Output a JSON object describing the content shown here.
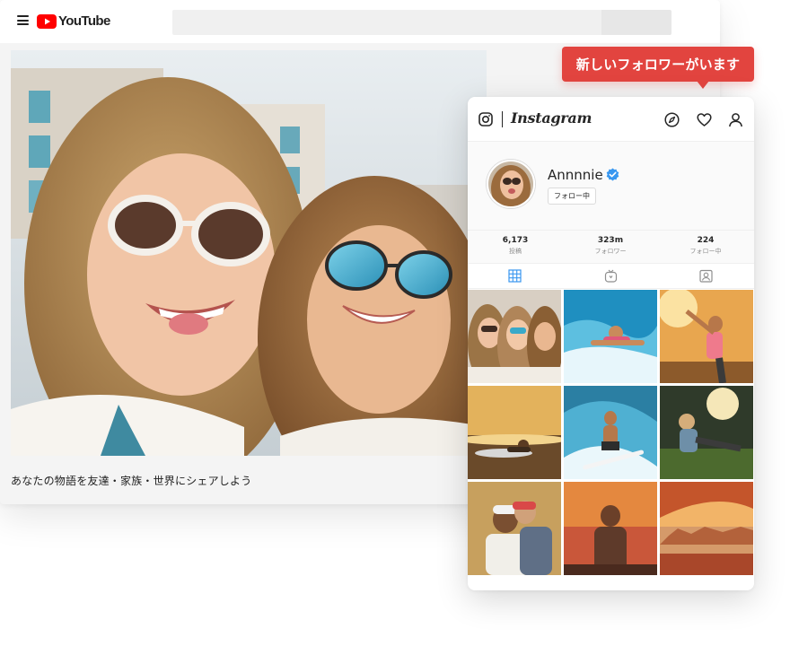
{
  "youtube": {
    "logo_text": "YouTube",
    "brand_color": "#ff0000",
    "menu_icon": "hamburger-menu-icon",
    "search": {
      "placeholder": ""
    },
    "video": {
      "description": "あなたの物語を友達・家族・世界にシェアしよう"
    }
  },
  "notification": {
    "text": "新しいフォロワーがいます",
    "color": "#e2443f"
  },
  "instagram": {
    "wordmark": "Instagram",
    "header_icons": [
      "camera-icon",
      "compass-icon",
      "heart-icon",
      "person-icon"
    ],
    "profile": {
      "username": "Annnnie",
      "verified": true,
      "verified_color": "#3897f0",
      "follow_button": "フォロー中"
    },
    "stats": [
      {
        "value": "6,173",
        "label": "投稿"
      },
      {
        "value": "323m",
        "label": "フォロワー"
      },
      {
        "value": "224",
        "label": "フォロー中"
      }
    ],
    "tabs": [
      "grid-icon",
      "igtv-icon",
      "tagged-icon"
    ],
    "active_tab_color": "#3897f0",
    "grid": [
      "friends-selfie",
      "surfer-wave",
      "woman-stretching",
      "surfboard-sunset",
      "surfer-riding",
      "runner-stretching",
      "couple-piggyback",
      "man-desert-sunset",
      "canyon-arch"
    ]
  }
}
